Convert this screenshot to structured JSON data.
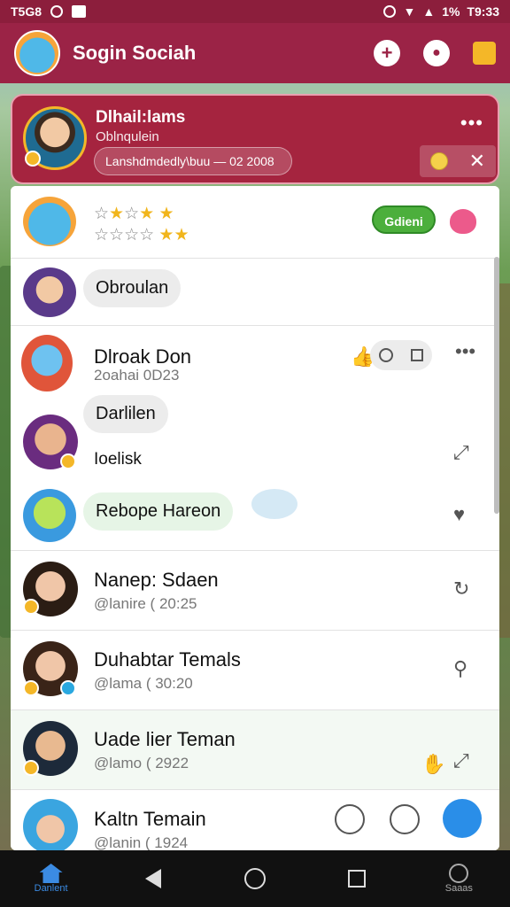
{
  "status_bar": {
    "time": "T5G8",
    "battery": "1%",
    "clock_right": "T9:33"
  },
  "app_bar": {
    "title": "Sogin Sociah"
  },
  "banner": {
    "name": "Dlhail:lams",
    "subtitle": "Oblnqulein",
    "status_text": "Lanshdmdedly\\buu — 02 2008"
  },
  "sponsored_row": {
    "button_label": "Gdieni"
  },
  "chats": [
    {
      "name": "Obroulan",
      "kind": "bubble"
    },
    {
      "name": "Dlroak Don",
      "meta": "2oahai     0D23"
    },
    {
      "name": "Darlilen",
      "kind": "bubble"
    },
    {
      "name": "Ioelisk",
      "kind": "text"
    },
    {
      "name": "Rebope Hareon",
      "kind": "bubble"
    },
    {
      "name": "Nanep: Sdaen",
      "meta": "@lanire ( 20:25"
    },
    {
      "name": "Duhabtar Temals",
      "meta": "@lama ( 30:20"
    },
    {
      "name": "Uade lier Teman",
      "meta": "@lamo ( 2922"
    },
    {
      "name": "Kaltn Temain",
      "meta": "@lanin ( 1924"
    }
  ],
  "nav": {
    "home_label": "Danlent",
    "right_label": "Saaas"
  },
  "colors": {
    "brand": "#9b2346",
    "accent_green": "#4caf3c",
    "nav_active": "#3b8be3"
  }
}
